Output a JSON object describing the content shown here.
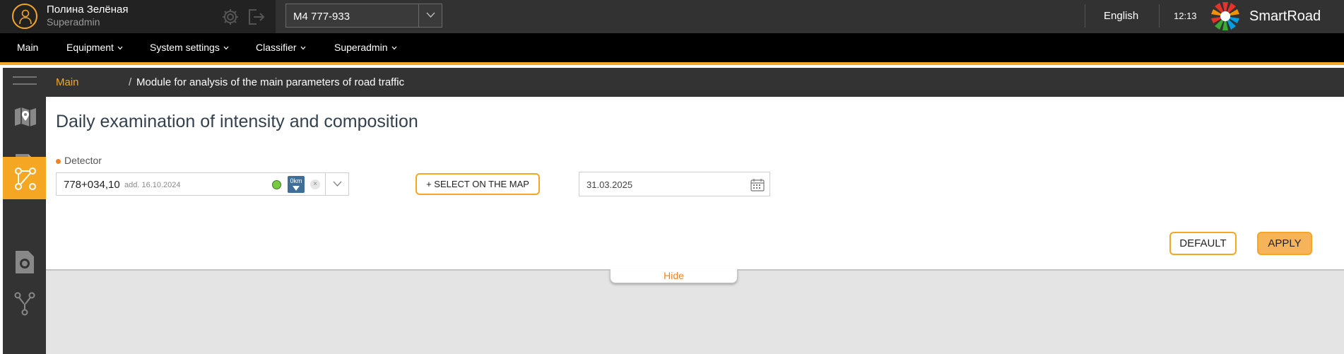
{
  "user": {
    "name": "Полина Зелёная",
    "role": "Superadmin"
  },
  "route_select": {
    "value": "M4 777-933"
  },
  "language": "English",
  "clock": "12:13",
  "brand": {
    "name": "SmartRoad"
  },
  "nav": {
    "items": [
      "Main",
      "Equipment",
      "System settings",
      "Classifier",
      "Superadmin"
    ]
  },
  "breadcrumb": {
    "main": "Main",
    "separator": "/",
    "current": "Module for analysis of the main parameters of road traffic"
  },
  "page": {
    "title": "Daily examination of intensity and composition"
  },
  "detector": {
    "label": "Detector",
    "value": "778+034,10",
    "added": "add. 16.10.2024",
    "badge": "0km",
    "clear": "×"
  },
  "select_on_map": {
    "label": "+ SELECT ON THE MAP"
  },
  "date": {
    "value": "31.03.2025"
  },
  "buttons": {
    "default": "DEFAULT",
    "apply": "APPLY"
  },
  "hide": {
    "label": "Hide"
  },
  "colors": {
    "accent": "#f5a623",
    "topbar": "#323232",
    "navbar": "#000000",
    "rail": "#333333",
    "status_ok": "#7ac943",
    "badge": "#3f6f99"
  },
  "icons": {
    "rail": [
      "menu-icon",
      "map-icon",
      "report-icon",
      "routes-icon",
      "camera-icon",
      "nodes-icon"
    ],
    "top": [
      "user-icon",
      "gear-icon",
      "logout-icon",
      "chevron-down-icon",
      "smartroad-logo-icon"
    ],
    "detector": [
      "status-dot-icon",
      "distance-badge-icon",
      "clear-icon",
      "chevron-down-icon"
    ],
    "date": "calendar-icon"
  }
}
